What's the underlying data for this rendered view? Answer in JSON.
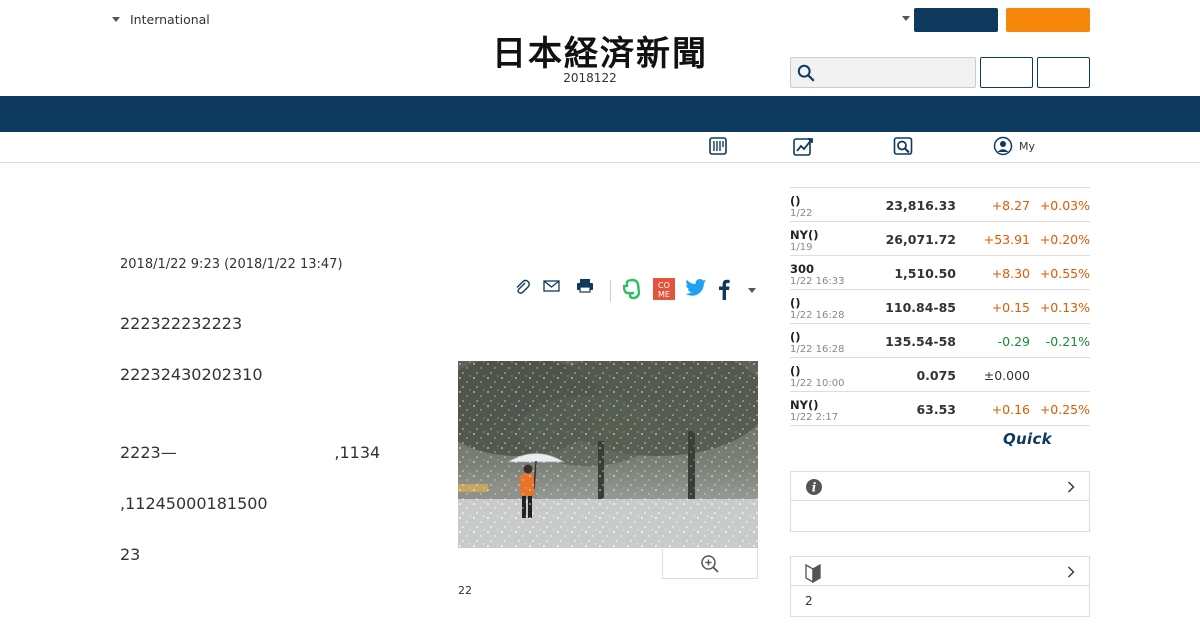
{
  "header": {
    "edition_selector": "International",
    "masthead": "日本経済新聞",
    "date_line": "2018122",
    "login_label": "",
    "subscribe_label": "",
    "search": {
      "value": "",
      "placeholder": ""
    },
    "search_button_1": "",
    "search_button_2": "",
    "colors": {
      "navy": "#0e3a60",
      "orange": "#f7870b"
    }
  },
  "subnav": {
    "items": [
      {
        "icon": "newspaper-icon",
        "label": ""
      },
      {
        "icon": "chart-icon",
        "label": ""
      },
      {
        "icon": "search-doc-icon",
        "label": ""
      },
      {
        "icon": "user-icon",
        "label": "My"
      }
    ]
  },
  "article": {
    "published": "2018/1/22 9:23 (2018/1/22 13:47)",
    "share_icons": [
      "clip-icon",
      "mail-icon",
      "print-icon",
      "evernote-icon",
      "come-icon",
      "twitter-icon",
      "facebook-icon",
      "more-icon"
    ],
    "come_label": "CO\nME",
    "paragraphs": [
      "222322232223",
      "22232430202310",
      "2223—                               ,1134",
      ",11245000181500",
      "23"
    ],
    "photo_caption": "22"
  },
  "market": {
    "rows": [
      {
        "name": "()",
        "time": "1/22",
        "value": "23,816.33",
        "change": "+8.27",
        "pct": "+0.03%",
        "dir": "up"
      },
      {
        "name": "NY()",
        "time": "1/19",
        "value": "26,071.72",
        "change": "+53.91",
        "pct": "+0.20%",
        "dir": "up"
      },
      {
        "name": "300",
        "time": "1/22 16:33",
        "value": "1,510.50",
        "change": "+8.30",
        "pct": "+0.55%",
        "dir": "up"
      },
      {
        "name": "()",
        "time": "1/22 16:28",
        "value": "110.84-85",
        "change": "+0.15",
        "pct": "+0.13%",
        "dir": "up"
      },
      {
        "name": "()",
        "time": "1/22 16:28",
        "value": "135.54-58",
        "change": "-0.29",
        "pct": "-0.21%",
        "dir": "down"
      },
      {
        "name": "()",
        "time": "1/22 10:00",
        "value": "0.075",
        "change": "±0.000",
        "pct": "",
        "dir": "flat"
      },
      {
        "name": "NY()",
        "time": "1/22 2:17",
        "value": "63.53",
        "change": "+0.16",
        "pct": "+0.25%",
        "dir": "up"
      }
    ],
    "provider": "Quick"
  },
  "info_box": {
    "title": "",
    "body": ""
  },
  "beginner_box": {
    "title": "",
    "body": "2"
  }
}
